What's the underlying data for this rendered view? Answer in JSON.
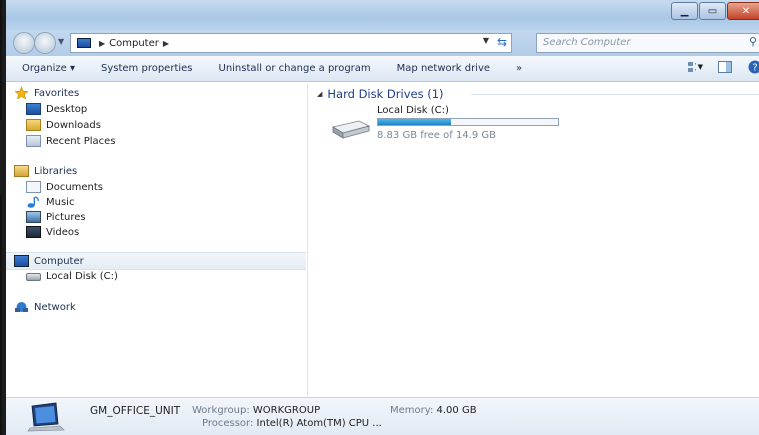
{
  "addressbar": {
    "crumbs": [
      "Computer"
    ],
    "search_placeholder": "Search Computer"
  },
  "commandbar": {
    "items": [
      "Organize ▾",
      "System properties",
      "Uninstall or change a program",
      "Map network drive",
      "»"
    ]
  },
  "navpane": {
    "favorites": {
      "label": "Favorites",
      "items": [
        "Desktop",
        "Downloads",
        "Recent Places"
      ]
    },
    "libraries": {
      "label": "Libraries",
      "items": [
        "Documents",
        "Music",
        "Pictures",
        "Videos"
      ]
    },
    "computer": {
      "label": "Computer",
      "items": [
        "Local Disk (C:)"
      ]
    },
    "network": {
      "label": "Network"
    }
  },
  "content": {
    "group_header": "Hard Disk Drives (1)",
    "drive": {
      "name": "Local Disk (C:)",
      "free_text": "8.83 GB free of 14.9 GB",
      "used_fraction": 0.407
    }
  },
  "details": {
    "computer_name": "GM_OFFICE_UNIT",
    "workgroup_label": "Workgroup:",
    "workgroup_value": "WORKGROUP",
    "memory_label": "Memory:",
    "memory_value": "4.00 GB",
    "processor_label": "Processor:",
    "processor_value": "Intel(R) Atom(TM) CPU ..."
  },
  "colors": {
    "accent": "#1f84c4",
    "group_header": "#1e3e8a"
  }
}
